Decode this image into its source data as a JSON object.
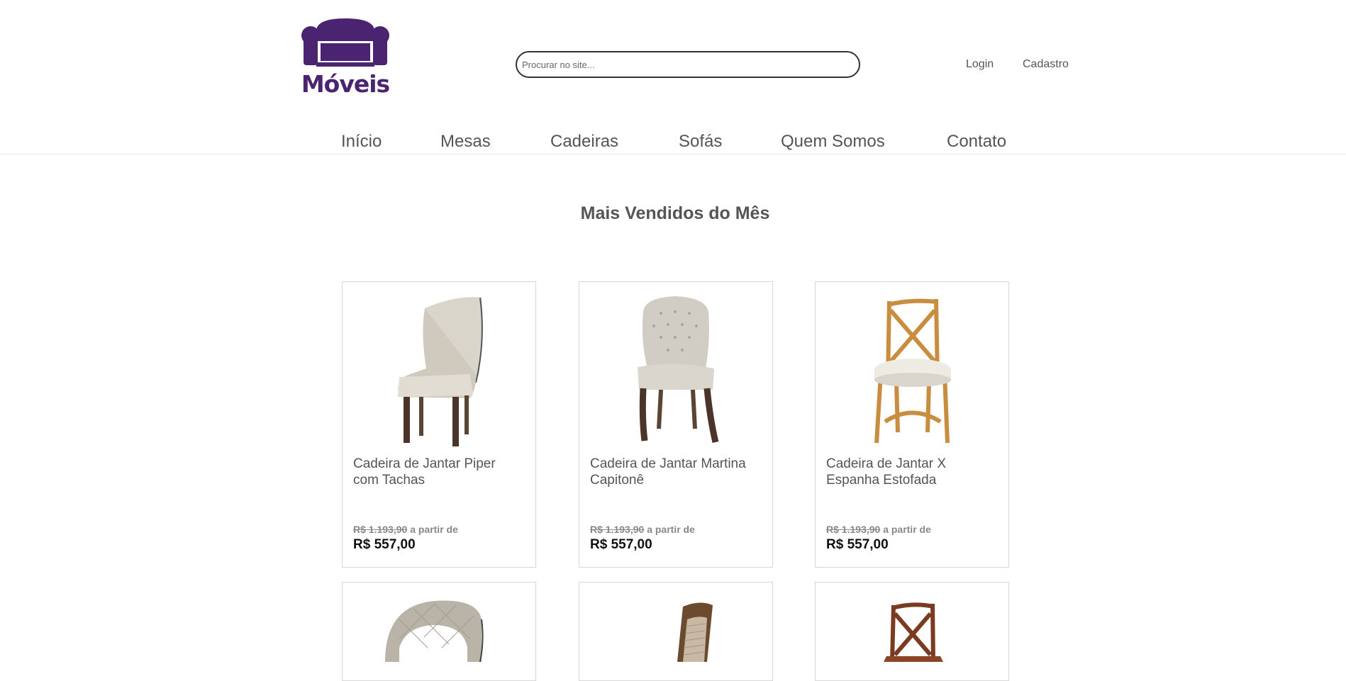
{
  "brand": {
    "name": "Móveis",
    "color": "#4a2470"
  },
  "search": {
    "placeholder": "Procurar no site..."
  },
  "user_links": {
    "login": "Login",
    "register": "Cadastro"
  },
  "nav": {
    "items": [
      "Início",
      "Mesas",
      "Cadeiras",
      "Sofás",
      "Quem Somos",
      "Contato"
    ]
  },
  "section": {
    "title": "Mais Vendidos do Mês"
  },
  "products": [
    {
      "name": "Cadeira de Jantar Piper com Tachas",
      "old_price": "R$ 1.193,90",
      "from_label": "a partir de",
      "price": "R$ 557,00",
      "image": "cream-upholstered-chair"
    },
    {
      "name": "Cadeira de Jantar Martina Capitonê",
      "old_price": "R$ 1.193,90",
      "from_label": "a partir de",
      "price": "R$ 557,00",
      "image": "tufted-grey-chair"
    },
    {
      "name": "Cadeira de Jantar X Espanha Estofada",
      "old_price": "R$ 1.193,90",
      "from_label": "a partir de",
      "price": "R$ 557,00",
      "image": "wooden-x-back-chair"
    },
    {
      "image": "quilted-round-back-chair"
    },
    {
      "image": "dark-wood-chair"
    },
    {
      "image": "dark-wood-x-back-chair"
    }
  ]
}
